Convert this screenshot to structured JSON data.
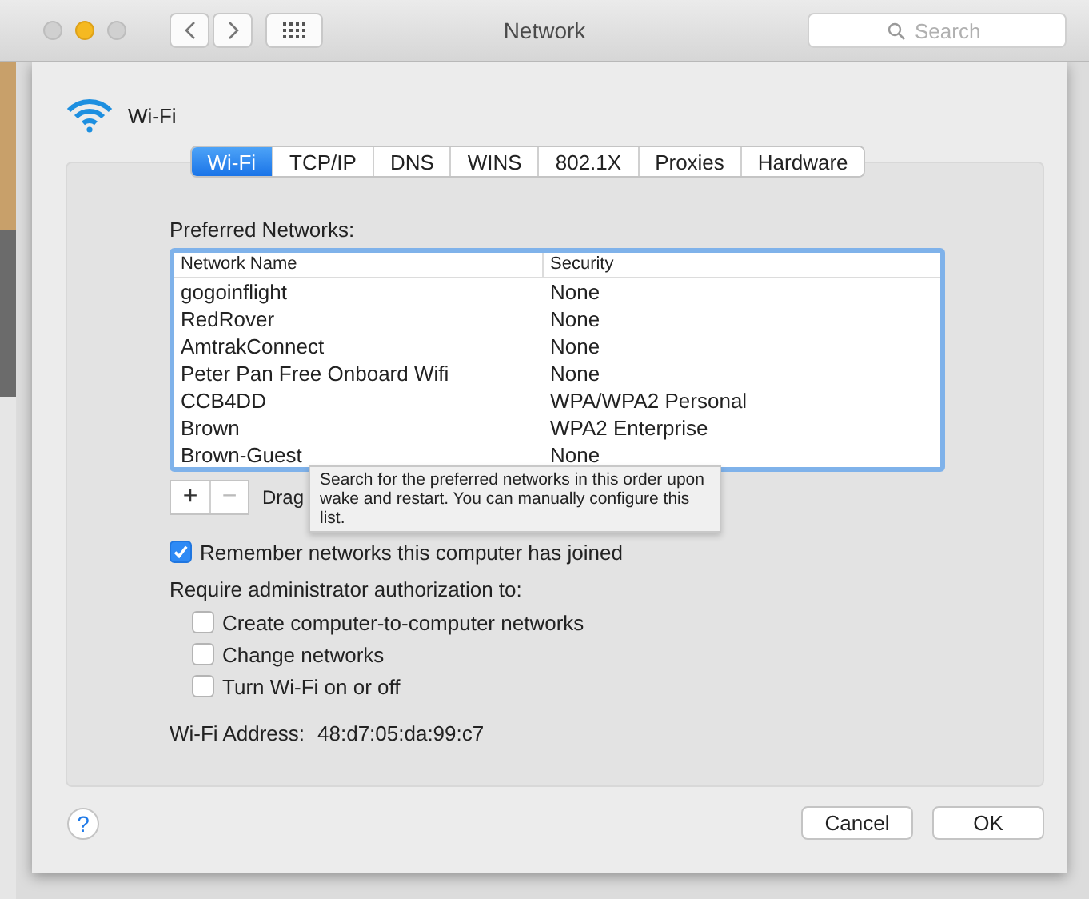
{
  "window": {
    "title": "Network",
    "search": {
      "placeholder": "Search"
    }
  },
  "service": {
    "name": "Wi-Fi"
  },
  "tabs": [
    {
      "label": "Wi-Fi",
      "selected": true
    },
    {
      "label": "TCP/IP",
      "selected": false
    },
    {
      "label": "DNS",
      "selected": false
    },
    {
      "label": "WINS",
      "selected": false
    },
    {
      "label": "802.1X",
      "selected": false
    },
    {
      "label": "Proxies",
      "selected": false
    },
    {
      "label": "Hardware",
      "selected": false
    }
  ],
  "preferred_networks": {
    "label": "Preferred Networks:",
    "columns": [
      "Network Name",
      "Security"
    ],
    "rows": [
      [
        "gogoinflight",
        "None"
      ],
      [
        "RedRover",
        "None"
      ],
      [
        "AmtrakConnect",
        "None"
      ],
      [
        "Peter Pan Free Onboard Wifi",
        "None"
      ],
      [
        "CCB4DD",
        "WPA/WPA2 Personal"
      ],
      [
        "Brown",
        "WPA2 Enterprise"
      ],
      [
        "Brown-Guest",
        "None"
      ]
    ],
    "add": "+",
    "remove": "−",
    "hint": "Drag",
    "tooltip": "Search for the preferred networks in this order upon wake and restart. You can manually configure this list."
  },
  "remember": {
    "label": "Remember networks this computer has joined",
    "checked": true
  },
  "admin": {
    "label": "Require administrator authorization to:",
    "options": [
      {
        "label": "Create computer-to-computer networks",
        "checked": false
      },
      {
        "label": "Change networks",
        "checked": false
      },
      {
        "label": "Turn Wi-Fi on or off",
        "checked": false
      }
    ]
  },
  "address": {
    "label": "Wi-Fi Address:",
    "value": "48:d7:05:da:99:c7"
  },
  "buttons": {
    "help": "?",
    "cancel": "Cancel",
    "ok": "OK"
  }
}
